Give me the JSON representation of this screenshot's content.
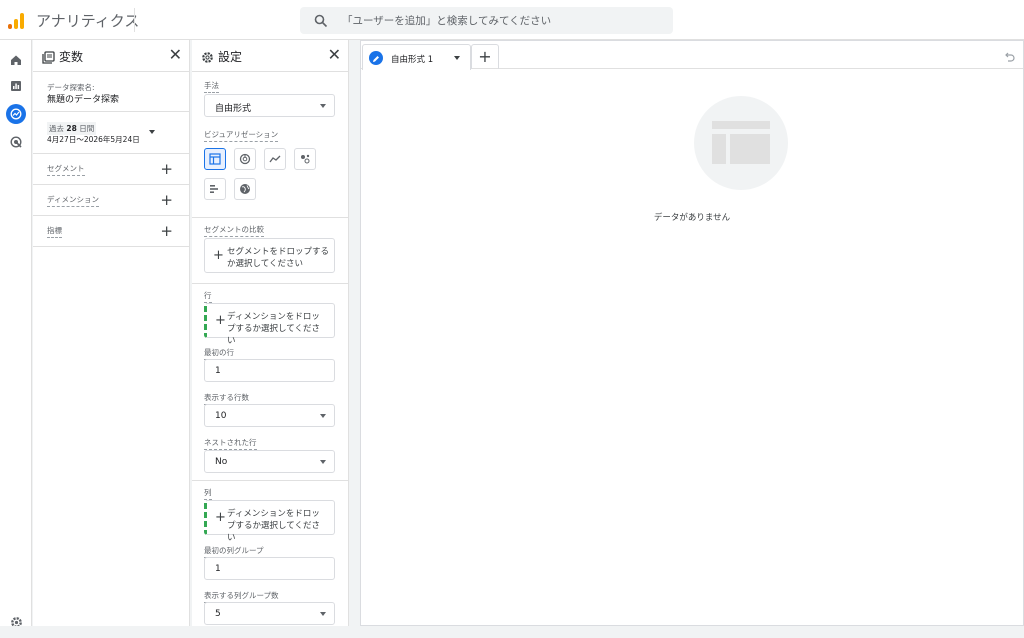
{
  "app": {
    "title": "アナリティクス"
  },
  "search": {
    "placeholder": "「ユーザーを追加」と検索してみてください"
  },
  "rail": {
    "items": [
      "home-icon",
      "reports-icon",
      "explore-icon",
      "advertising-icon"
    ],
    "bottom": "gear-icon"
  },
  "variables": {
    "title": "変数",
    "exploration_name_label": "データ探索名:",
    "exploration_name": "無題のデータ探索",
    "date_prefix": "過去",
    "date_days": "28",
    "date_suffix": "日間",
    "date_range": "4月27日～2026年5月24日",
    "sections": [
      "セグメント",
      "ディメンション",
      "指標"
    ]
  },
  "settings": {
    "title": "設定",
    "technique_label": "手法",
    "technique_value": "自由形式",
    "viz_label": "ビジュアリゼーション",
    "segment_compare_label": "セグメントの比較",
    "segment_drop": "セグメントをドロップするか選択してください",
    "rows_label": "行",
    "rows_drop": "ディメンションをドロップするか選択してください",
    "first_row_label": "最初の行",
    "first_row_value": "1",
    "show_rows_label": "表示する行数",
    "show_rows_value": "10",
    "nested_label": "ネストされた行",
    "nested_value": "No",
    "columns_label": "列",
    "columns_drop": "ディメンションをドロップするか選択してください",
    "first_col_label": "最初の列グループ",
    "first_col_value": "1",
    "show_cols_label": "表示する列グループ数",
    "show_cols_value": "5"
  },
  "canvas": {
    "tab_label": "自由形式 1",
    "empty_text": "データがありません"
  },
  "colors": {
    "accent": "#1a73e8",
    "drop_border": "#34a853"
  }
}
